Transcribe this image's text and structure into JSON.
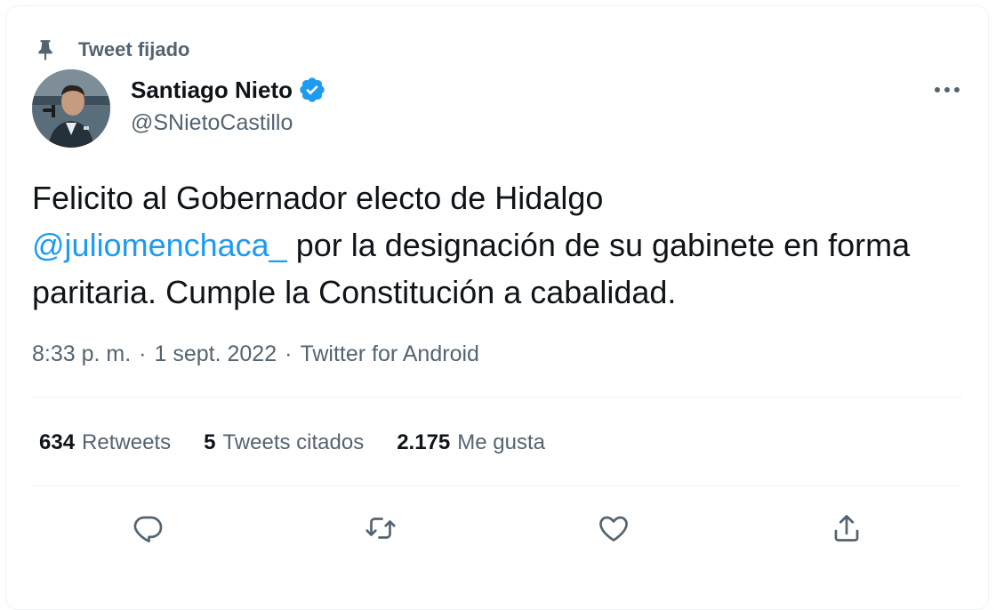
{
  "pinned": {
    "label": "Tweet fijado",
    "icon": "pin-icon"
  },
  "author": {
    "name": "Santiago Nieto",
    "handle": "@SNietoCastillo",
    "verified_icon": "verified-badge-icon",
    "avatar": "avatar"
  },
  "more_icon": "more-icon",
  "tweet": {
    "text_line1": "Felicito al Gobernador electo de Hidalgo",
    "mention": "@juliomenchaca_",
    "text_after_mention": " por la designación de su gabinete en forma paritaria. Cumple la Constitución a cabalidad."
  },
  "meta": {
    "time": "8:33 p. m.",
    "separator": "·",
    "date": "1 sept. 2022",
    "source": "Twitter for Android"
  },
  "stats": [
    {
      "value": "634",
      "label": "Retweets"
    },
    {
      "value": "5",
      "label": "Tweets citados"
    },
    {
      "value": "2.175",
      "label": "Me gusta"
    }
  ],
  "actions": [
    "reply-icon",
    "retweet-icon",
    "like-icon",
    "share-icon"
  ],
  "colors": {
    "accent": "#1d9bf0",
    "text_primary": "#0f1419",
    "text_secondary": "#536471",
    "divider": "#eff3f4"
  }
}
